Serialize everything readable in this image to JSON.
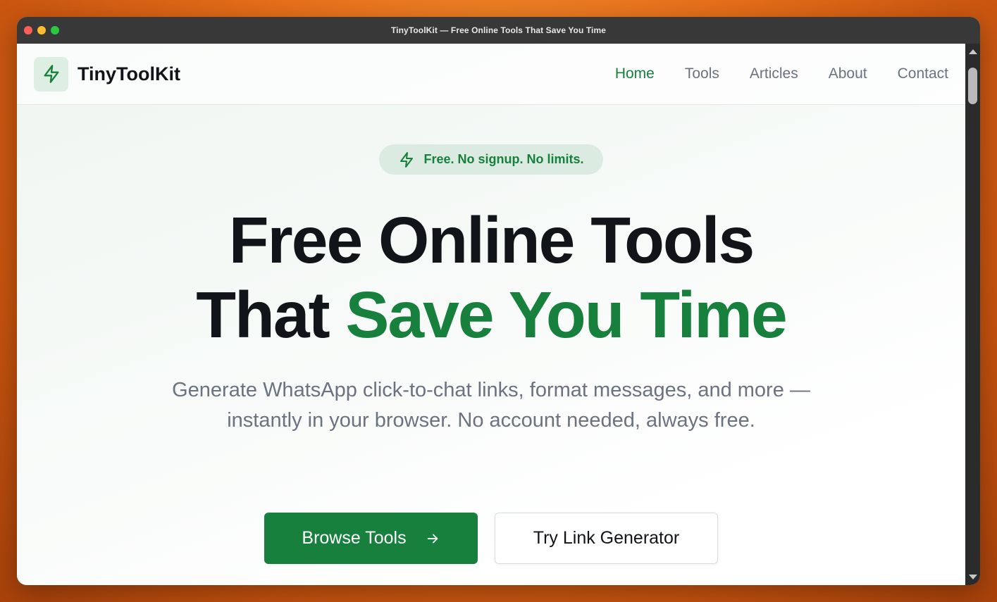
{
  "window": {
    "title": "TinyToolKit — Free Online Tools That Save You Time"
  },
  "header": {
    "brand": "TinyToolKit",
    "logo_icon": "lightning-bolt-icon",
    "nav": [
      {
        "label": "Home",
        "active": true
      },
      {
        "label": "Tools",
        "active": false
      },
      {
        "label": "Articles",
        "active": false
      },
      {
        "label": "About",
        "active": false
      },
      {
        "label": "Contact",
        "active": false
      }
    ]
  },
  "hero": {
    "badge": "Free. No signup. No limits.",
    "badge_icon": "lightning-bolt-icon",
    "headline_line1": "Free Online Tools",
    "headline_line2_plain": "That ",
    "headline_line2_accent": "Save You Time",
    "subtitle_line1": "Generate WhatsApp click-to-chat links, format messages, and more —",
    "subtitle_line2": "instantly in your browser. No account needed, always free.",
    "primary_button": "Browse Tools",
    "primary_button_icon": "arrow-right-icon",
    "secondary_button": "Try Link Generator"
  },
  "colors": {
    "accent": "#17803d",
    "text_dark": "#111418",
    "text_muted": "#6b7280",
    "badge_bg": "#dcebe1"
  }
}
